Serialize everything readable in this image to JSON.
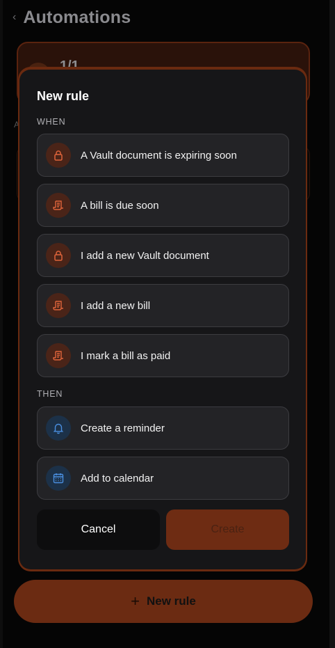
{
  "background": {
    "back_glyph": "‹",
    "title": "Automations",
    "card_count": "1/1",
    "section_letter": "A"
  },
  "modal": {
    "title": "New rule",
    "when_label": "WHEN",
    "then_label": "THEN",
    "when_options": [
      {
        "label": "A Vault document is expiring soon",
        "icon": "lock-icon"
      },
      {
        "label": "A bill is due soon",
        "icon": "receipt-icon"
      },
      {
        "label": "I add a new Vault document",
        "icon": "lock-icon"
      },
      {
        "label": "I add a new bill",
        "icon": "receipt-icon"
      },
      {
        "label": "I mark a bill as paid",
        "icon": "receipt-icon"
      }
    ],
    "then_options": [
      {
        "label": "Create a reminder",
        "icon": "bell-icon"
      },
      {
        "label": "Add to calendar",
        "icon": "calendar-icon"
      }
    ],
    "cancel_label": "Cancel",
    "create_label": "Create"
  },
  "fab": {
    "plus": "+",
    "label": "New rule"
  },
  "colors": {
    "accent": "#e0643a",
    "accent_dim": "#6e2c13",
    "blue": "#4a8fe0",
    "surface": "#161618",
    "option_bg": "#232326"
  }
}
